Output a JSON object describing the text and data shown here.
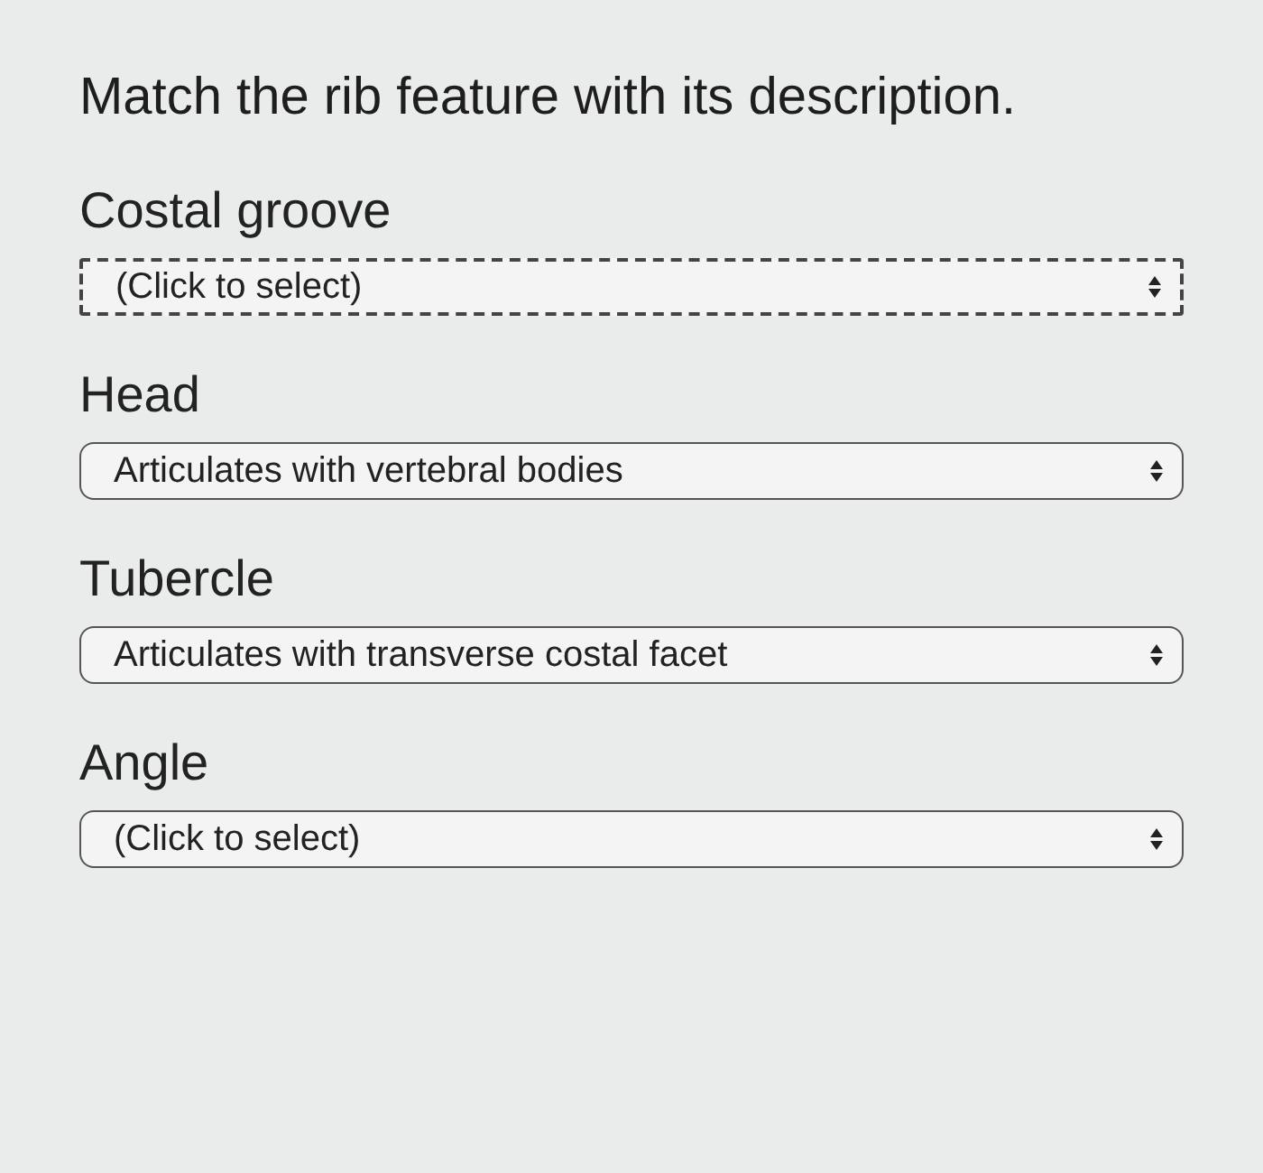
{
  "question": "Match the rib feature with its description.",
  "items": [
    {
      "label": "Costal groove",
      "value": "(Click to select)",
      "focused": true
    },
    {
      "label": "Head",
      "value": "Articulates with vertebral bodies",
      "focused": false
    },
    {
      "label": "Tubercle",
      "value": "Articulates with transverse costal facet",
      "focused": false
    },
    {
      "label": "Angle",
      "value": "(Click to select)",
      "focused": false
    }
  ]
}
